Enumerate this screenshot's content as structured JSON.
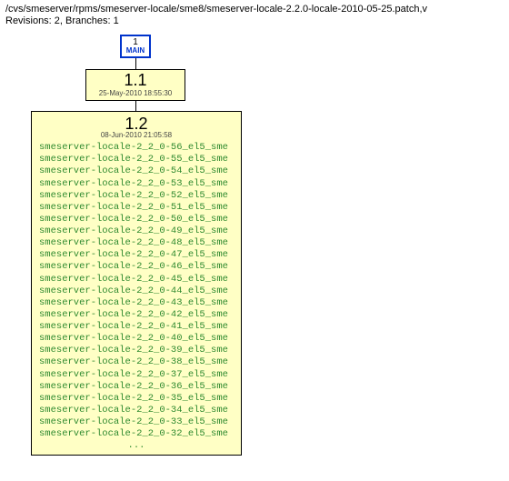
{
  "header": {
    "path": "/cvs/smeserver/rpms/smeserver-locale/sme8/smeserver-locale-2.2.0-locale-2010-05-25.patch,v",
    "meta": "Revisions: 2, Branches: 1"
  },
  "main_branch": {
    "num": "1",
    "label": "MAIN"
  },
  "rev_1_1": {
    "num": "1.1",
    "date": "25-May-2010 18:55:30"
  },
  "rev_1_2": {
    "num": "1.2",
    "date": "08-Jun-2010 21:05:58",
    "tags": [
      "smeserver-locale-2_2_0-56_el5_sme",
      "smeserver-locale-2_2_0-55_el5_sme",
      "smeserver-locale-2_2_0-54_el5_sme",
      "smeserver-locale-2_2_0-53_el5_sme",
      "smeserver-locale-2_2_0-52_el5_sme",
      "smeserver-locale-2_2_0-51_el5_sme",
      "smeserver-locale-2_2_0-50_el5_sme",
      "smeserver-locale-2_2_0-49_el5_sme",
      "smeserver-locale-2_2_0-48_el5_sme",
      "smeserver-locale-2_2_0-47_el5_sme",
      "smeserver-locale-2_2_0-46_el5_sme",
      "smeserver-locale-2_2_0-45_el5_sme",
      "smeserver-locale-2_2_0-44_el5_sme",
      "smeserver-locale-2_2_0-43_el5_sme",
      "smeserver-locale-2_2_0-42_el5_sme",
      "smeserver-locale-2_2_0-41_el5_sme",
      "smeserver-locale-2_2_0-40_el5_sme",
      "smeserver-locale-2_2_0-39_el5_sme",
      "smeserver-locale-2_2_0-38_el5_sme",
      "smeserver-locale-2_2_0-37_el5_sme",
      "smeserver-locale-2_2_0-36_el5_sme",
      "smeserver-locale-2_2_0-35_el5_sme",
      "smeserver-locale-2_2_0-34_el5_sme",
      "smeserver-locale-2_2_0-33_el5_sme",
      "smeserver-locale-2_2_0-32_el5_sme"
    ],
    "ellipsis": "..."
  }
}
